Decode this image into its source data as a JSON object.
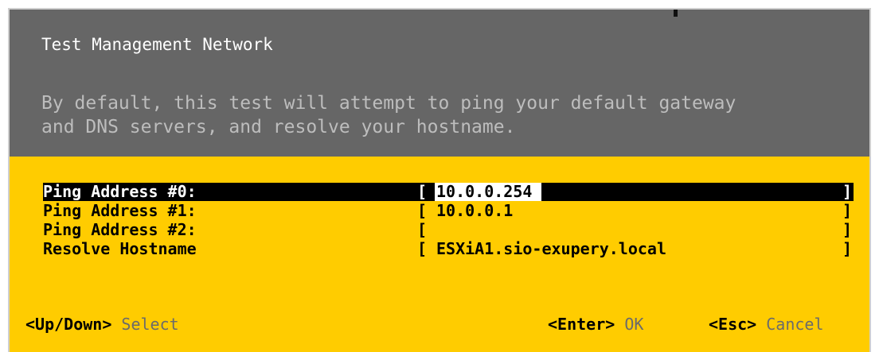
{
  "header": {
    "title": "Test Management Network",
    "description": "By default, this test will attempt to ping your default gateway\nand DNS servers, and resolve your hostname."
  },
  "fields": [
    {
      "label": "Ping Address #0:",
      "value": "10.0.0.254",
      "selected": true
    },
    {
      "label": "Ping Address #1:",
      "value": "10.0.0.1",
      "selected": false
    },
    {
      "label": "Ping Address #2:",
      "value": "",
      "selected": false
    },
    {
      "label": "Resolve Hostname",
      "value": "ESXiA1.sio-exupery.local",
      "selected": false
    }
  ],
  "brackets": {
    "open": "[",
    "close": "]"
  },
  "footer": {
    "nav_key": "<Up/Down>",
    "nav_action": "Select",
    "ok_key": "<Enter>",
    "ok_action": "OK",
    "cancel_key": "<Esc>",
    "cancel_action": "Cancel"
  },
  "colors": {
    "header_bg": "#666666",
    "body_bg": "#ffcc00",
    "selected_row": "#000000"
  }
}
